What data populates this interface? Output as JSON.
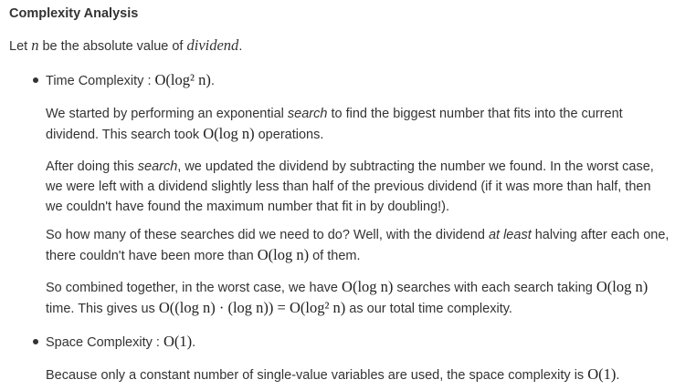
{
  "heading": "Complexity Analysis",
  "intro": {
    "prefix": "Let ",
    "var_n": "n",
    "middle": " be the absolute value of ",
    "dividend_var": "dividend",
    "suffix": "."
  },
  "time": {
    "label": "Time Complexity : ",
    "math": "O(log² n)",
    "suffix": ".",
    "p1": {
      "a": "We started by performing an exponential ",
      "em": "search",
      "b": " to find the biggest number that fits into the current",
      "line2_a": "dividend. This search took ",
      "math": "O(log n)",
      "line2_b": " operations."
    },
    "p2": {
      "a": "After doing this ",
      "em": "search",
      "b": ", we updated the dividend by subtracting the number we found. In the worst case,",
      "line2": "we were left with a dividend slightly less than half of the previous dividend (if it was more than half, then",
      "line3": "we couldn't have found the maximum number that fit in by doubling!)."
    },
    "p3": {
      "a": "So how many of these searches did we need to do? Well, with the dividend ",
      "em": "at least",
      "b": " halving after each one,",
      "line2_a": "there couldn't have been more than ",
      "math": "O(log n)",
      "line2_b": " of them."
    },
    "p4": {
      "a": "So combined together, in the worst case, we have ",
      "math1": "O(log n)",
      "b": " searches with each search taking ",
      "math2": "O(log n)",
      "line2_a": "time. This gives us ",
      "math3": "O((log n) · (log n)) = O(log² n)",
      "line2_b": " as our total time complexity."
    }
  },
  "space": {
    "label": "Space Complexity : ",
    "math": "O(1)",
    "suffix": ".",
    "p1": {
      "a": "Because only a constant number of single-value variables are used, the space complexity is ",
      "math": "O(1)",
      "b": "."
    }
  }
}
